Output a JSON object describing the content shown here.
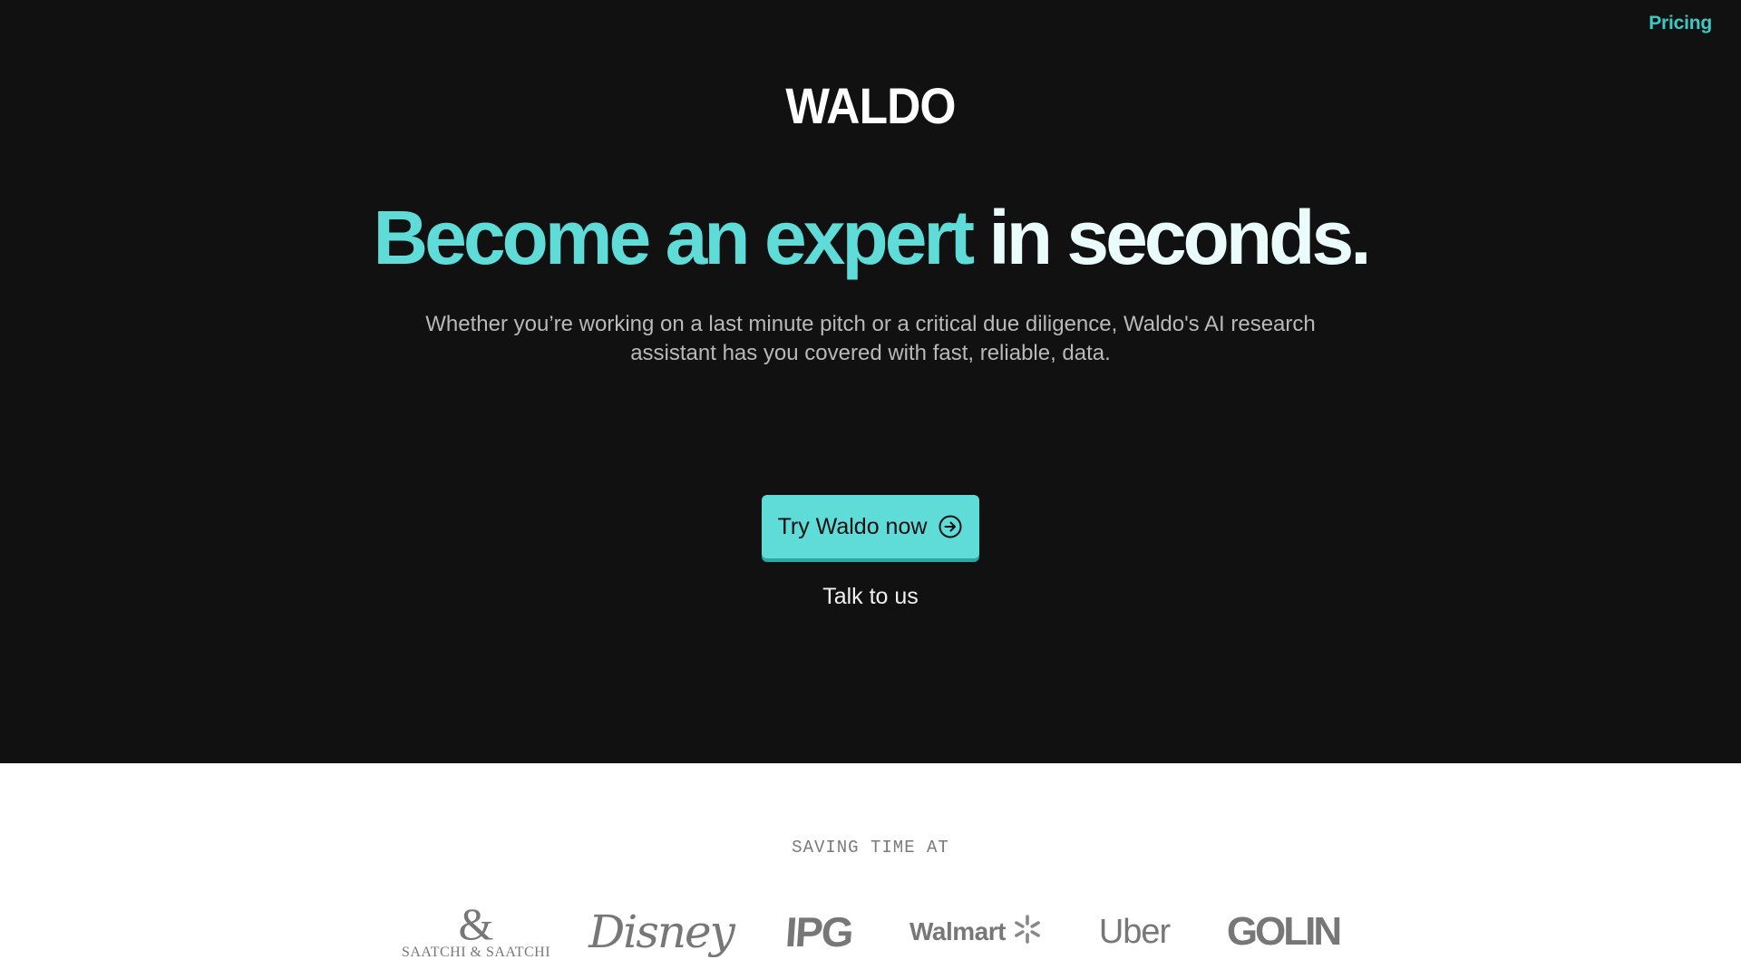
{
  "nav": {
    "pricing_label": "Pricing"
  },
  "hero": {
    "logo_text": "WALDO",
    "headline_accent": "Become an expert",
    "headline_rest": "in seconds.",
    "subtitle": "Whether you’re working on a last minute pitch or a critical due diligence, Waldo's AI research assistant has you covered with fast, reliable, data.",
    "cta_label": "Try Waldo now",
    "cta_icon": "arrow-right-circle-icon",
    "secondary_label": "Talk to us"
  },
  "clients": {
    "label": "SAVING TIME AT",
    "logos": [
      {
        "name": "Saatchi & Saatchi",
        "mark": "&",
        "text": "SAATCHI & SAATCHI"
      },
      {
        "name": "Disney",
        "text": "Disney"
      },
      {
        "name": "IPG",
        "text": "IPG"
      },
      {
        "name": "Walmart",
        "text": "Walmart",
        "icon": "walmart-spark-icon"
      },
      {
        "name": "Uber",
        "text": "Uber"
      },
      {
        "name": "Golin",
        "text": "GOLIN"
      }
    ]
  },
  "colors": {
    "background_dark": "#111111",
    "accent": "#5fdcd7",
    "pricing_link": "#3ec9c2",
    "headline_light": "#e9fbfb",
    "subtitle": "#b9b9b9",
    "client_logo_gray": "#777777"
  }
}
